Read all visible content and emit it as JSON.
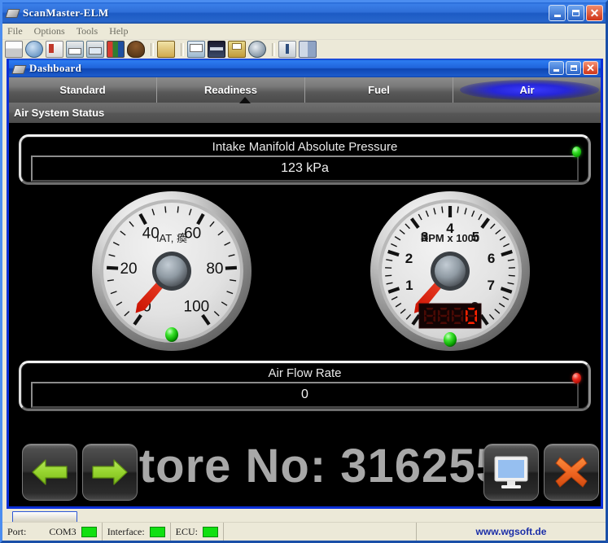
{
  "app": {
    "title": "ScanMaster-ELM",
    "icon": "chip-icon",
    "menu": [
      "File",
      "Options",
      "Tools",
      "Help"
    ],
    "window_controls": {
      "minimize": "_",
      "maximize": "□",
      "close": "✕"
    },
    "toolbar_icons": [
      "new-icon",
      "globe-icon",
      "report-icon",
      "scan-icon",
      "monitor-icon",
      "colors-icon",
      "sensor-icon",
      "print-icon",
      "window-icon",
      "bar-icon",
      "save-icon",
      "gauge-icon",
      "graph-icon",
      "exit-icon"
    ]
  },
  "dashboard": {
    "title": "Dashboard",
    "icon": "chip-icon",
    "window_controls": {
      "minimize": "_",
      "maximize": "□",
      "close": "✕"
    },
    "tabs": [
      {
        "label": "Standard",
        "active": false
      },
      {
        "label": "Readiness",
        "active": false
      },
      {
        "label": "Fuel",
        "active": false
      },
      {
        "label": "Air",
        "active": true
      }
    ],
    "section_title": "Air System Status",
    "watermark": "Store No: 316255",
    "panels": [
      {
        "id": "map",
        "title": "Intake Manifold Absolute Pressure",
        "value": "123 kPa",
        "led": "green"
      },
      {
        "id": "maf",
        "title": "Air Flow Rate",
        "value": "0",
        "led": "red"
      }
    ],
    "gauges": [
      {
        "id": "iat",
        "caption": "IAT, 瘓",
        "ticks": [
          "0",
          "20",
          "40",
          "60",
          "80",
          "100"
        ],
        "min": 0,
        "max": 100,
        "value": 2,
        "led": "green",
        "has_lcd": false
      },
      {
        "id": "rpm",
        "caption": "RPM x 1000",
        "ticks": [
          "0",
          "1",
          "2",
          "3",
          "4",
          "5",
          "6",
          "7",
          "8"
        ],
        "min": 0,
        "max": 8,
        "value": 0.15,
        "led": "green",
        "has_lcd": true,
        "lcd_value": "0",
        "lcd_digits": 4
      }
    ],
    "buttons": [
      {
        "id": "prev",
        "icon": "arrow-left-icon",
        "label": "Previous"
      },
      {
        "id": "next",
        "icon": "arrow-right-icon",
        "label": "Next"
      },
      {
        "id": "display",
        "icon": "monitor-icon",
        "label": "Display"
      },
      {
        "id": "close",
        "icon": "close-x-icon",
        "label": "Close"
      }
    ]
  },
  "statusbar": {
    "port_label": "Port:",
    "port_value": "COM3",
    "port_led": "green",
    "interface_label": "Interface:",
    "interface_led": "green",
    "ecu_label": "ECU:",
    "ecu_led": "green",
    "url": "www.wgsoft.de"
  },
  "colors": {
    "accent_blue": "#0b2fd8",
    "led_green": "#11e011",
    "led_red": "#ef2a1e",
    "needle_red": "#e81c00",
    "arrow_green": "#8fd42a",
    "close_orange": "#ef6421"
  }
}
